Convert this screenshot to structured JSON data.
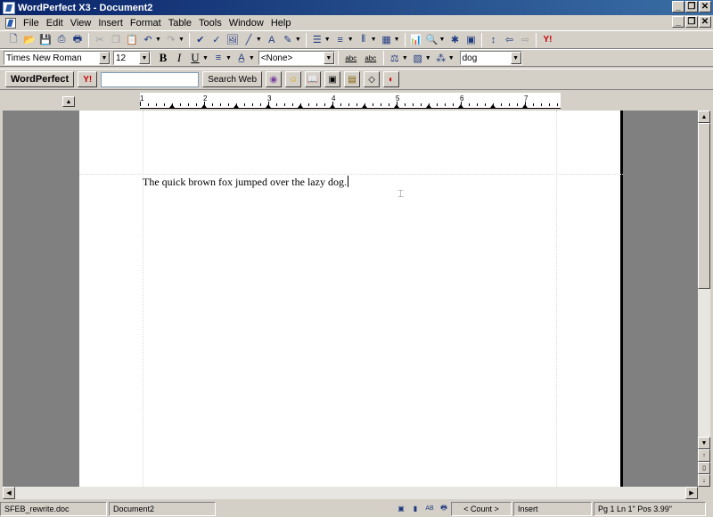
{
  "window": {
    "title": "WordPerfect X3 - Document2"
  },
  "window_controls": {
    "minimize": "_",
    "maximize": "❒",
    "close": "✕"
  },
  "menu": [
    "File",
    "Edit",
    "View",
    "Insert",
    "Format",
    "Table",
    "Tools",
    "Window",
    "Help"
  ],
  "toolbar1": {
    "buttons": [
      "new-icon",
      "open-icon",
      "save-icon",
      "print-preview-icon",
      "print-icon",
      "cut-icon",
      "copy-icon",
      "paste-icon",
      "undo-icon",
      "redo-icon",
      "spell-check-icon",
      "grammar-icon",
      "clipart-icon",
      "line-icon",
      "textbox-icon",
      "highlight-icon",
      "numbering-icon",
      "bullets-icon",
      "columns-icon",
      "table-icon",
      "chart-icon",
      "zoom-icon",
      "asterisk-icon",
      "reveal-codes-icon",
      "resize-icon",
      "back-icon",
      "forward-icon",
      "yahoo-icon"
    ]
  },
  "toolbar2": {
    "font": "Times New Roman",
    "size": "12",
    "bold": "B",
    "italic": "I",
    "underline": "U",
    "style": "<None>",
    "abc1": "abc",
    "abc2": "abc",
    "find": "dog"
  },
  "toolbar3": {
    "wordperfect_btn": "WordPerfect",
    "yahoo_label": "Y!",
    "search_input": "",
    "search_btn": "Search Web"
  },
  "ruler": {
    "labels": [
      "1",
      "2",
      "3",
      "4",
      "5",
      "6",
      "7"
    ]
  },
  "document": {
    "text": "The quick brown fox jumped over the lazy dog."
  },
  "status": {
    "file": "SFEB_rewrite.doc",
    "doc": "Document2",
    "count": "< Count >",
    "mode": "Insert",
    "position": "Pg 1 Ln 1\" Pos 3.99\""
  }
}
